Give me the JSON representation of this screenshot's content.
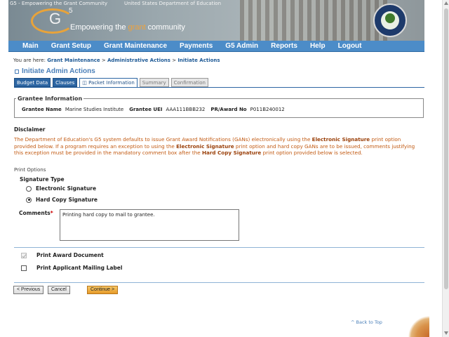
{
  "banner": {
    "logo_alt": "G5 - Empowering the Grant Community",
    "seal_alt": "United States Department of Education",
    "logo_text": "G",
    "logo_sup": "5",
    "tagline_prefix": "Empowering the ",
    "tagline_accent": "grant",
    "tagline_suffix": " community"
  },
  "nav": {
    "items": [
      "Main",
      "Grant Setup",
      "Grant Maintenance",
      "Payments",
      "G5 Admin",
      "Reports",
      "Help",
      "Logout"
    ]
  },
  "breadcrumb": {
    "prefix": "You are here:",
    "items": [
      "Grant Maintenance",
      "Administrative Actions",
      "Initiate Actions"
    ],
    "separator": ">"
  },
  "page": {
    "title": "Initiate Admin Actions"
  },
  "tabs": [
    {
      "label": "Budget Data",
      "state": "blue"
    },
    {
      "label": "Clauses",
      "state": "blue"
    },
    {
      "label": "Packet Information",
      "state": "active"
    },
    {
      "label": "Summary",
      "state": "disabled"
    },
    {
      "label": "Confirmation",
      "state": "disabled"
    }
  ],
  "grantee": {
    "legend": "Grantee Information",
    "name_label": "Grantee Name",
    "name_value": "Marine Studies Institute",
    "uei_label": "Grantee UEI",
    "uei_value": "AAA111BBB232",
    "award_label": "PR/Award No",
    "award_value": "P011B240012"
  },
  "disclaimer": {
    "title": "Disclaimer",
    "part1": "The Department of Education's G5 system defaults to issue Grant Award Notifications (GANs) electronically using the ",
    "bold1": "Electronic Signature",
    "part2": " print option provided below. If a program requires an exception to using the ",
    "bold2": "Electronic Signature",
    "part3": " print option and hard copy GANs are to be issued, comments justifying this exception must be provided in the mandatory comment box after the ",
    "bold3": "Hard Copy Signature",
    "part4": " print option provided below is selected."
  },
  "print_options": {
    "section_label": "Print Options",
    "signature_type_label": "Signature Type",
    "electronic_label": "Electronic Signature",
    "hard_copy_label": "Hard Copy Signature",
    "selected": "hard_copy",
    "comments_label": "Comments",
    "required_mark": "*",
    "comments_value": "Printing hard copy to mail to grantee."
  },
  "checkboxes": {
    "award_doc_label": "Print Award Document",
    "award_doc_checked": true,
    "award_doc_disabled": true,
    "mailing_label": "Print Applicant Mailing Label",
    "mailing_checked": false
  },
  "buttons": {
    "previous": "< Previous",
    "cancel": "Cancel",
    "continue": "Continue >"
  },
  "footer": {
    "back_to_top": "^ Back to Top"
  }
}
